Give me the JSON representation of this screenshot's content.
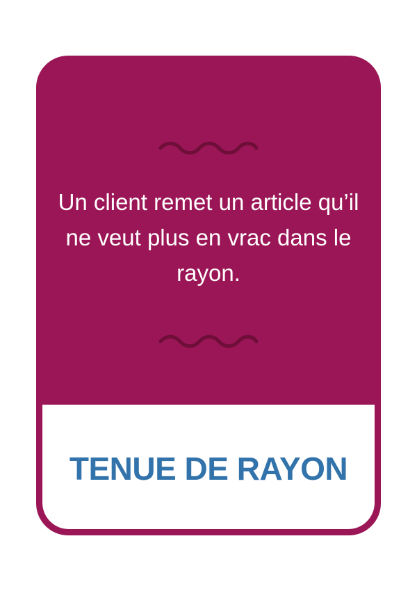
{
  "card": {
    "statement": "Un client remet un article qu’il ne veut plus en vrac dans le rayon.",
    "category": "TENUE DE RAYON"
  },
  "colors": {
    "card_background": "#9b1656",
    "wave_ornament": "#6e0e39",
    "category_text": "#3273ab",
    "statement_text": "#ffffff"
  },
  "icons": {
    "top_ornament": "wavy-line-icon",
    "bottom_ornament": "wavy-line-icon"
  }
}
